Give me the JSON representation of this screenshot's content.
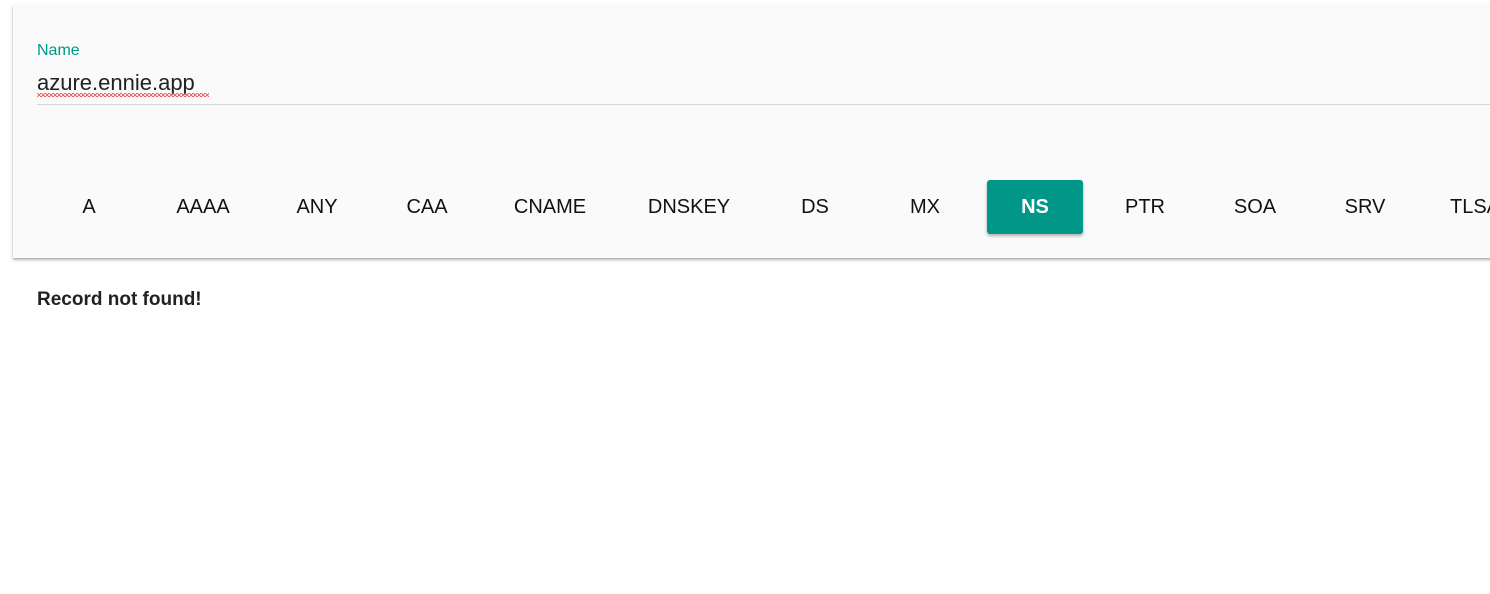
{
  "name_field": {
    "label": "Name",
    "value": "azure.ennie.app"
  },
  "record_types": [
    {
      "label": "A",
      "selected": false
    },
    {
      "label": "AAAA",
      "selected": false
    },
    {
      "label": "ANY",
      "selected": false
    },
    {
      "label": "CAA",
      "selected": false
    },
    {
      "label": "CNAME",
      "selected": false
    },
    {
      "label": "DNSKEY",
      "selected": false
    },
    {
      "label": "DS",
      "selected": false
    },
    {
      "label": "MX",
      "selected": false
    },
    {
      "label": "NS",
      "selected": true
    },
    {
      "label": "PTR",
      "selected": false
    },
    {
      "label": "SOA",
      "selected": false
    },
    {
      "label": "SRV",
      "selected": false
    },
    {
      "label": "TLSA",
      "selected": false
    }
  ],
  "result": {
    "message": "Record not found!"
  },
  "colors": {
    "accent": "#009688"
  }
}
